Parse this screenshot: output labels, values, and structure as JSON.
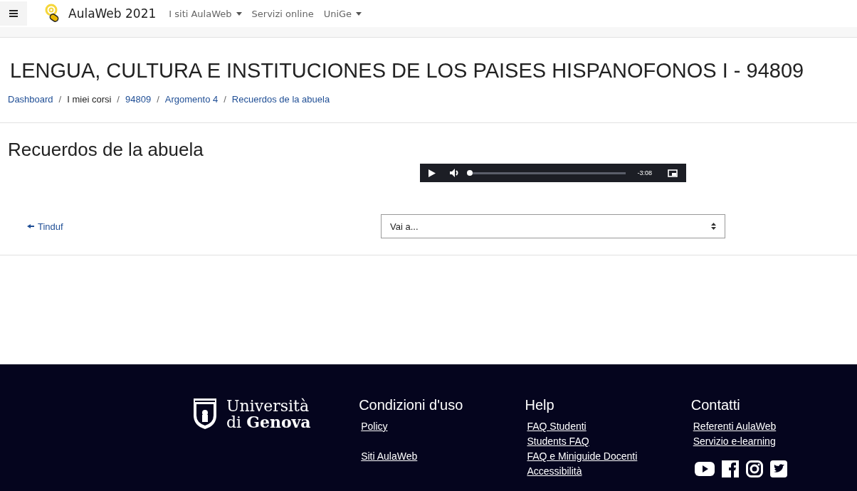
{
  "navbar": {
    "site_name": "AulaWeb 2021",
    "menu": [
      {
        "label": "I siti AulaWeb",
        "dropdown": true
      },
      {
        "label": "Servizi online",
        "dropdown": false
      },
      {
        "label": "UniGe",
        "dropdown": true
      }
    ]
  },
  "page_title": "LENGUA, CULTURA E INSTITUCIONES DE LOS PAISES HISPANOFONOS I - 94809",
  "breadcrumb": [
    {
      "label": "Dashboard",
      "link": true
    },
    {
      "separator": "/",
      "label": "I miei corsi",
      "link": false
    },
    {
      "separator": "/",
      "label": "94809",
      "link": true
    },
    {
      "separator": "/",
      "label": "Argomento 4",
      "link": true
    },
    {
      "separator": "/",
      "label": "Recuerdos de la abuela",
      "link": true
    }
  ],
  "heading": "Recuerdos de la abuela",
  "audio_player": {
    "time": "-3:08",
    "level": 0
  },
  "prev_link": "Tinduf",
  "jump_select": {
    "placeholder": "Vai a..."
  },
  "footer": {
    "logo": [
      "Università",
      "di **Genova**"
    ],
    "columns": [
      {
        "title": "Condizioni d'uso",
        "link_groups": [
          [
            "Policy"
          ],
          [
            "Siti AulaWeb"
          ]
        ]
      },
      {
        "title": "Help",
        "link_groups": [
          [
            "FAQ Studenti",
            "Students FAQ",
            "FAQ e Miniguide Docenti",
            "Accessibilità"
          ]
        ]
      },
      {
        "title": "Contatti",
        "link_groups": [
          [
            "Referenti AulaWeb",
            "Servizio e-learning"
          ]
        ]
      }
    ]
  }
}
